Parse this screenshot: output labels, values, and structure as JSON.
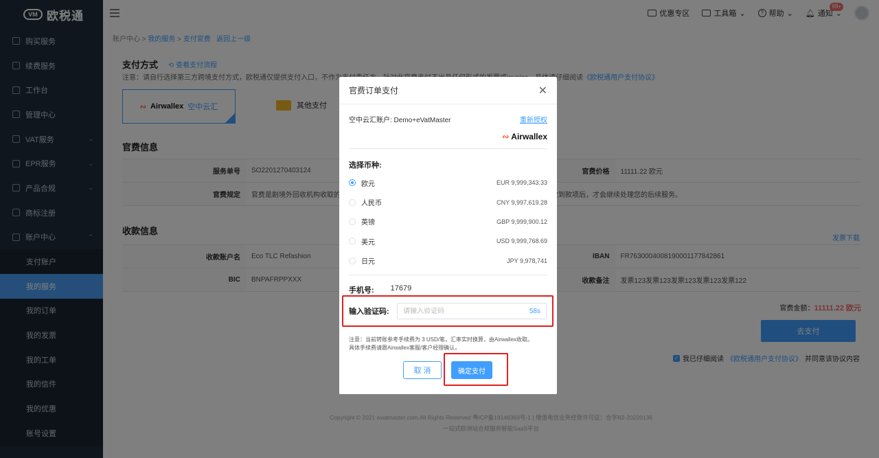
{
  "app": {
    "logo_text": "欧税通",
    "logo_mark": "VM"
  },
  "sidebar": {
    "items": [
      {
        "label": "购买服务"
      },
      {
        "label": "续费服务"
      },
      {
        "label": "工作台"
      },
      {
        "label": "管理中心"
      },
      {
        "label": "VAT服务"
      },
      {
        "label": "EPR服务"
      },
      {
        "label": "产品合规"
      },
      {
        "label": "商标注册"
      },
      {
        "label": "账户中心"
      }
    ],
    "sub_items": [
      {
        "label": "支付账户"
      },
      {
        "label": "我的服务"
      },
      {
        "label": "我的订单"
      },
      {
        "label": "我的发票"
      },
      {
        "label": "我的工单"
      },
      {
        "label": "我的信件"
      },
      {
        "label": "我的优惠"
      },
      {
        "label": "账号设置"
      }
    ]
  },
  "topbar": {
    "promo": "优惠专区",
    "toolbox": "工具箱",
    "help": "帮助",
    "notice": "通知",
    "notice_badge": "99+"
  },
  "breadcrumb": {
    "root": "账户中心",
    "sep": " > ",
    "level1": "我的服务",
    "level2": "支付官费",
    "back": "返回上一级"
  },
  "main": {
    "payment_title": "支付方式",
    "payment_flow_link": "查看支付流程",
    "notice_text": "注意：请自行选择第三方跨境支付方式，欧税通仅提供支付入口，不作为支付责任方，针对此官费支付不出具任何形式的发票或invoice，具体请仔细阅读",
    "notice_link": "《欧税通用户支付协议》",
    "pm_airwallex": "Airwallex",
    "pm_airwallex_zh": "空中云汇",
    "pm_other": "其他支付",
    "fee_info_title": "官费信息",
    "service_no_label": "服务单号",
    "service_no": "SO2201270403124",
    "fee_price_label": "官费价格",
    "fee_price": "11111.22 欧元",
    "fee_rule_label": "官费规定",
    "fee_rule": "官费是剧境外回收机构收取的",
    "fee_rule_tail": "收到款项后，才会继续处理您的后续服务。",
    "recv_title": "收款信息",
    "invoice_download": "发票下载",
    "recv_account_label": "收款账户名",
    "recv_account": "Eco TLC Refashion",
    "iban_label": "IBAN",
    "iban": "FR7630004008190001177842861",
    "bic_label": "BIC",
    "bic": "BNPAFRPPXXX",
    "memo_label": "收款备注",
    "memo": "发票123发票123发票123发票123发票122",
    "total_label": "官费金额：",
    "total_value": "11111.22 欧元",
    "go_pay": "去支付",
    "agree_text": "我已仔细阅读",
    "agree_link": "《欧税通用户支付协议》",
    "agree_tail": "并同意该协议内容"
  },
  "footer": {
    "line1": "Copyright © 2021 evatmaster.com,All Rights Reserved 粤ICP备19146369号-1  |  增值电信业务经营许可证：合字B2-20220136",
    "line2": "一站式欧洲站合规服务智能SaaS平台"
  },
  "modal": {
    "title": "官费订单支付",
    "close": "✕",
    "account_label": "空中云汇账户: Demo+eVatMaster",
    "reauth": "重新授权",
    "brand": "Airwallex",
    "currency_title": "选择币种:",
    "currencies": [
      {
        "name": "欧元",
        "amount": "EUR 9,999,343.33",
        "selected": true
      },
      {
        "name": "人民币",
        "amount": "CNY 9,997,619.28",
        "selected": false
      },
      {
        "name": "英镑",
        "amount": "GBP 9,999,900.12",
        "selected": false
      },
      {
        "name": "美元",
        "amount": "USD 9,999,768.69",
        "selected": false
      },
      {
        "name": "日元",
        "amount": "JPY 9,978,741",
        "selected": false
      }
    ],
    "phone_label": "手机号:",
    "phone_value": "17679",
    "code_label": "输入验证码:",
    "code_placeholder": "请输入验证码",
    "code_timer": "58s",
    "note_line1": "注意：当前转账参考手续费为 3 USD/笔，汇率实时换算，由Airwallex收取。",
    "note_line2": "具体手续费请跟Airwallex客服/客户经理确认。",
    "cancel": "取 消",
    "confirm": "确定支付"
  },
  "colors": {
    "accent": "#409eff",
    "sidebar_bg": "#1f2d3d",
    "highlight_red": "#e0201f",
    "amount_red": "#f56c6c"
  }
}
